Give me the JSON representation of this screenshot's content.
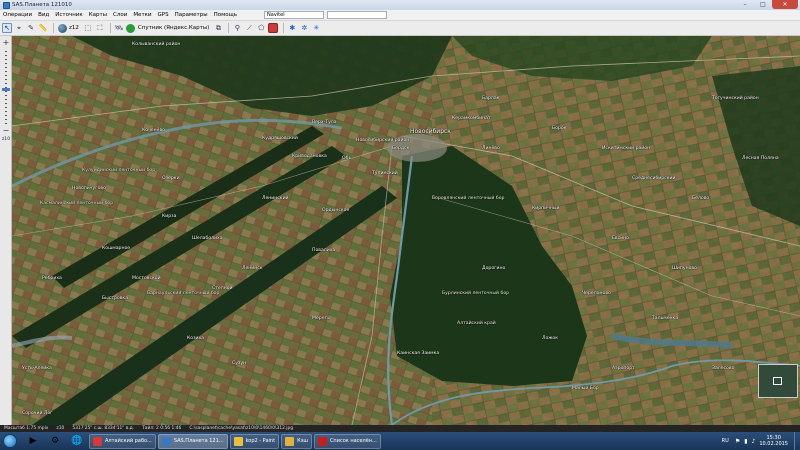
{
  "window": {
    "title": "SAS.Планета 121010"
  },
  "menu": {
    "items": [
      "Операции",
      "Вид",
      "Источник",
      "Карты",
      "Слои",
      "Метки",
      "GPS",
      "Параметры",
      "Помощь"
    ],
    "nav_source": "Navitel"
  },
  "toolbar": {
    "zoom_value": "z12",
    "map_source": "Спутник (Яндекс.Карты)"
  },
  "zoombar": {
    "level": "z10"
  },
  "map": {
    "labels": [
      "Новосибирск",
      "Новосибирский район",
      "Бердск",
      "Искитимский район",
      "Колыванский район",
      "Верх-Тула",
      "Барлак",
      "Тогучинский район",
      "Коченёво",
      "Кудряшовский",
      "Обь",
      "Криводановка",
      "Ордынское",
      "Кирза",
      "Новопичугово",
      "Ленинск",
      "Быстровка",
      "Сузун",
      "Мереть",
      "Тулинский",
      "Каинская Заимка",
      "Козиха",
      "Черепаново",
      "Ложок",
      "Линёво",
      "Евсино",
      "Белово",
      "Керамкомбинат",
      "Ленинский",
      "Степной",
      "Шипуново",
      "Малый Бор",
      "Дорогино",
      "Кошмарное",
      "Кирпичный",
      "Кулундинский ленточный бор",
      "Касмалинский ленточный бор",
      "Барнаульский ленточный бор",
      "Алтайский край",
      "Бурлинский ленточный бор",
      "Боровлянский ленточный бор",
      "Мостовской",
      "Аэропорт",
      "Залесово",
      "Усть-Алейка",
      "Шелаболиха",
      "Ребриха",
      "Тальменка",
      "Сорочий Лог",
      "Повалиха",
      "Борок",
      "Озерки",
      "Среднесибирский",
      "Лесная Поляна"
    ]
  },
  "statusbar": {
    "scale": "Масштаб 1:75 mpix",
    "zoom": "z10",
    "coords": "5317'25\" с.ш. 8334'11\" в.д.",
    "tile": "Тайл: 2 0:56 1:46",
    "file": "C:\\sasplanet\\cache\\yasat\\z10\\0\\1460\\0\\312.jpg"
  },
  "taskbar": {
    "tasks": [
      "Алтайский рабо...",
      "SAS.Планета 121...",
      "kop2 - Paint",
      "Кэш",
      "Список населён..."
    ],
    "lang": "RU",
    "time": "15:30",
    "date": "10.02.2015"
  },
  "colors": {
    "titlebar": "#c9d7e6",
    "taskbar": "#1a3558",
    "forest": "#1e3a1a",
    "river": "#6f9aa8"
  }
}
